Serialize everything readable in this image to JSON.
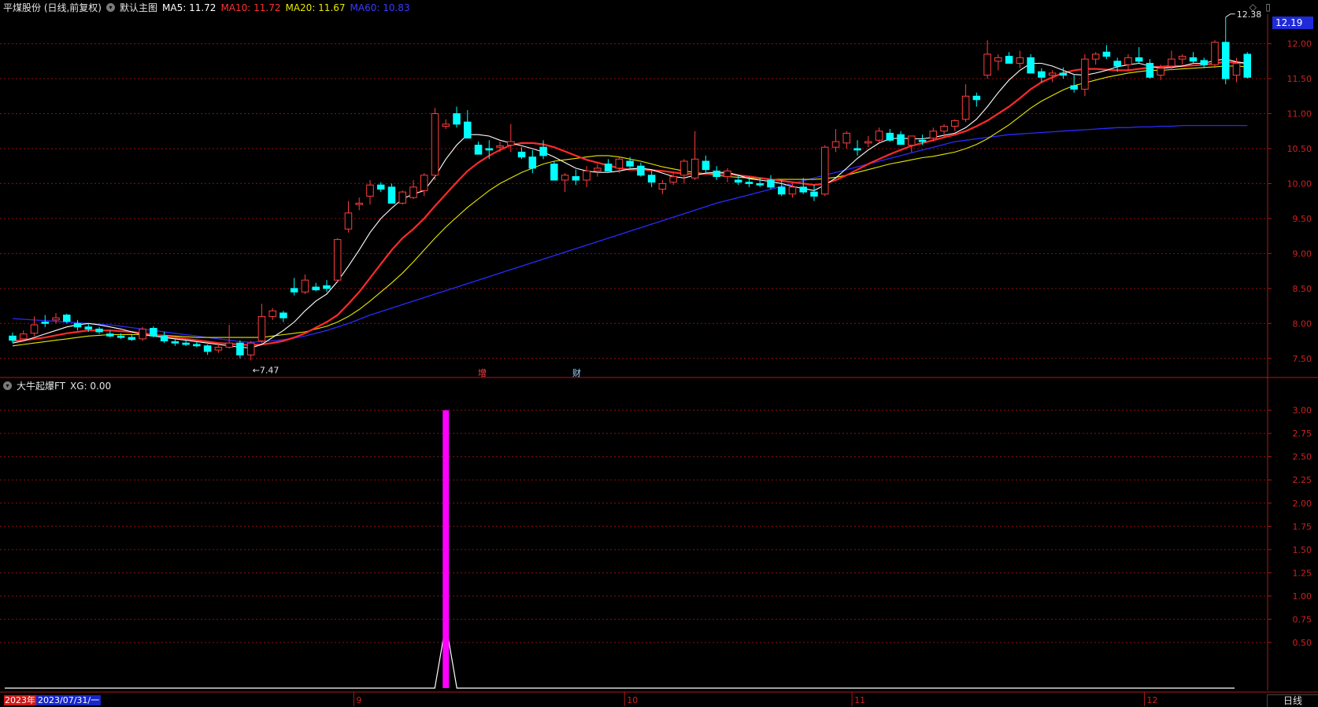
{
  "main_header": {
    "title": "平煤股份 (日线,前复权)",
    "template": "默认主图",
    "ma5": "MA5: 11.72",
    "ma10": "MA10: 11.72",
    "ma20": "MA20: 11.67",
    "ma60": "MA60: 10.83"
  },
  "sub_header": {
    "title": "大牛起爆FT",
    "value": "XG: 0.00"
  },
  "current_price": "12.19",
  "period_button": "日线",
  "date_cursor": {
    "year": "2023年",
    "date": "2023/07/31/一"
  },
  "event_markers": {
    "zeng": "增",
    "cai": "财"
  },
  "colors": {
    "up": "#ff3d3d",
    "down": "#00ffff",
    "ma5": "#ffffff",
    "ma10": "#ff2a2a",
    "ma20": "#e8e800",
    "ma60": "#2a2aff",
    "grid": "#8a1010",
    "xg": "#ff00ff"
  },
  "icons": {
    "dropdown": "chevron-down-icon",
    "diamond": "diamond-icon",
    "panel": "panel-toggle-icon"
  },
  "chart_data": [
    {
      "type": "candlestick",
      "title": "平煤股份 (日线,前复权)",
      "ylim": [
        7.25,
        12.4
      ],
      "y_ticks": [
        "7.50",
        "8.00",
        "8.50",
        "9.00",
        "9.50",
        "10.00",
        "10.50",
        "11.00",
        "11.50",
        "12.00"
      ],
      "x_ticks": [
        "9",
        "10",
        "11",
        "12"
      ],
      "x_tick_index": [
        32,
        57,
        78,
        105
      ],
      "annotations": {
        "high": "12.38",
        "low": "7.47"
      },
      "ohlc": [
        [
          7.82,
          7.87,
          7.72,
          7.76
        ],
        [
          7.78,
          7.9,
          7.75,
          7.85
        ],
        [
          7.86,
          8.1,
          7.82,
          7.98
        ],
        [
          8.02,
          8.12,
          7.95,
          8.0
        ],
        [
          8.05,
          8.15,
          8.0,
          8.08
        ],
        [
          8.12,
          8.14,
          8.0,
          8.03
        ],
        [
          8.0,
          8.05,
          7.9,
          7.95
        ],
        [
          7.95,
          8.0,
          7.88,
          7.92
        ],
        [
          7.92,
          7.95,
          7.85,
          7.88
        ],
        [
          7.85,
          7.9,
          7.8,
          7.82
        ],
        [
          7.82,
          7.86,
          7.78,
          7.8
        ],
        [
          7.8,
          7.85,
          7.75,
          7.77
        ],
        [
          7.78,
          7.95,
          7.75,
          7.92
        ],
        [
          7.93,
          7.96,
          7.8,
          7.82
        ],
        [
          7.82,
          7.88,
          7.72,
          7.75
        ],
        [
          7.74,
          7.78,
          7.68,
          7.72
        ],
        [
          7.72,
          7.76,
          7.68,
          7.7
        ],
        [
          7.7,
          7.74,
          7.66,
          7.68
        ],
        [
          7.68,
          7.7,
          7.55,
          7.6
        ],
        [
          7.62,
          7.7,
          7.58,
          7.66
        ],
        [
          7.66,
          7.98,
          7.64,
          7.72
        ],
        [
          7.72,
          7.76,
          7.5,
          7.55
        ],
        [
          7.55,
          7.75,
          7.47,
          7.72
        ],
        [
          7.75,
          8.28,
          7.72,
          8.1
        ],
        [
          8.1,
          8.22,
          8.05,
          8.18
        ],
        [
          8.15,
          8.18,
          8.02,
          8.08
        ],
        [
          8.5,
          8.65,
          8.4,
          8.45
        ],
        [
          8.45,
          8.7,
          8.42,
          8.62
        ],
        [
          8.52,
          8.58,
          8.46,
          8.48
        ],
        [
          8.54,
          8.62,
          8.45,
          8.5
        ],
        [
          8.62,
          9.22,
          8.58,
          9.2
        ],
        [
          9.35,
          9.75,
          9.3,
          9.58
        ],
        [
          9.7,
          9.8,
          9.62,
          9.72
        ],
        [
          9.82,
          10.05,
          9.7,
          9.98
        ],
        [
          9.98,
          10.02,
          9.88,
          9.92
        ],
        [
          9.95,
          10.0,
          9.78,
          9.72
        ],
        [
          9.72,
          9.9,
          9.7,
          9.88
        ],
        [
          9.8,
          10.05,
          9.78,
          9.95
        ],
        [
          9.9,
          10.15,
          9.82,
          10.12
        ],
        [
          10.12,
          11.08,
          10.05,
          11.0
        ],
        [
          10.82,
          10.92,
          10.78,
          10.85
        ],
        [
          11.0,
          11.1,
          10.8,
          10.85
        ],
        [
          10.88,
          11.05,
          10.65,
          10.65
        ],
        [
          10.55,
          10.6,
          10.45,
          10.42
        ],
        [
          10.5,
          10.62,
          10.35,
          10.48
        ],
        [
          10.52,
          10.6,
          10.45,
          10.54
        ],
        [
          10.55,
          10.85,
          10.45,
          10.6
        ],
        [
          10.45,
          10.52,
          10.35,
          10.38
        ],
        [
          10.38,
          10.48,
          10.15,
          10.22
        ],
        [
          10.52,
          10.62,
          10.35,
          10.4
        ],
        [
          10.28,
          10.32,
          10.05,
          10.05
        ],
        [
          10.05,
          10.15,
          9.88,
          10.12
        ],
        [
          10.1,
          10.2,
          9.98,
          10.05
        ],
        [
          10.05,
          10.25,
          9.95,
          10.18
        ],
        [
          10.18,
          10.28,
          10.1,
          10.22
        ],
        [
          10.28,
          10.35,
          10.2,
          10.18
        ],
        [
          10.22,
          10.38,
          10.15,
          10.35
        ],
        [
          10.32,
          10.38,
          10.22,
          10.25
        ],
        [
          10.25,
          10.3,
          10.1,
          10.12
        ],
        [
          10.12,
          10.18,
          9.95,
          10.02
        ],
        [
          9.92,
          10.05,
          9.85,
          10.0
        ],
        [
          10.02,
          10.15,
          9.98,
          10.1
        ],
        [
          10.12,
          10.35,
          10.0,
          10.32
        ],
        [
          10.08,
          10.75,
          10.05,
          10.35
        ],
        [
          10.32,
          10.4,
          10.15,
          10.2
        ],
        [
          10.18,
          10.25,
          10.05,
          10.1
        ],
        [
          10.1,
          10.22,
          10.02,
          10.18
        ],
        [
          10.05,
          10.12,
          9.98,
          10.02
        ],
        [
          10.02,
          10.1,
          9.95,
          10.0
        ],
        [
          10.0,
          10.08,
          9.95,
          9.98
        ],
        [
          10.05,
          10.12,
          9.92,
          9.95
        ],
        [
          9.95,
          10.05,
          9.82,
          9.85
        ],
        [
          9.85,
          10.0,
          9.8,
          9.95
        ],
        [
          9.95,
          10.08,
          9.85,
          9.88
        ],
        [
          9.88,
          9.98,
          9.75,
          9.82
        ],
        [
          9.85,
          10.55,
          9.82,
          10.52
        ],
        [
          10.52,
          10.78,
          10.45,
          10.6
        ],
        [
          10.58,
          10.75,
          10.5,
          10.72
        ],
        [
          10.5,
          10.62,
          10.4,
          10.48
        ],
        [
          10.58,
          10.68,
          10.52,
          10.6
        ],
        [
          10.62,
          10.8,
          10.58,
          10.75
        ],
        [
          10.72,
          10.78,
          10.6,
          10.62
        ],
        [
          10.7,
          10.75,
          10.58,
          10.56
        ],
        [
          10.55,
          10.68,
          10.45,
          10.68
        ],
        [
          10.62,
          10.7,
          10.55,
          10.6
        ],
        [
          10.65,
          10.8,
          10.6,
          10.75
        ],
        [
          10.75,
          10.85,
          10.65,
          10.82
        ],
        [
          10.82,
          10.92,
          10.75,
          10.9
        ],
        [
          10.92,
          11.42,
          10.88,
          11.25
        ],
        [
          11.25,
          11.3,
          11.1,
          11.2
        ],
        [
          11.55,
          12.05,
          11.5,
          11.85
        ],
        [
          11.75,
          11.85,
          11.62,
          11.8
        ],
        [
          11.82,
          11.88,
          11.75,
          11.72
        ],
        [
          11.72,
          11.9,
          11.65,
          11.8
        ],
        [
          11.8,
          11.85,
          11.6,
          11.58
        ],
        [
          11.6,
          11.65,
          11.45,
          11.52
        ],
        [
          11.55,
          11.62,
          11.45,
          11.58
        ],
        [
          11.58,
          11.66,
          11.5,
          11.55
        ],
        [
          11.4,
          11.55,
          11.3,
          11.35
        ],
        [
          11.35,
          11.85,
          11.25,
          11.78
        ],
        [
          11.78,
          11.88,
          11.7,
          11.85
        ],
        [
          11.88,
          11.98,
          11.78,
          11.82
        ],
        [
          11.75,
          11.8,
          11.6,
          11.68
        ],
        [
          11.7,
          11.85,
          11.62,
          11.8
        ],
        [
          11.8,
          11.95,
          11.72,
          11.75
        ],
        [
          11.72,
          11.78,
          11.5,
          11.52
        ],
        [
          11.55,
          11.7,
          11.48,
          11.65
        ],
        [
          11.68,
          11.9,
          11.62,
          11.78
        ],
        [
          11.78,
          11.85,
          11.7,
          11.82
        ],
        [
          11.8,
          11.88,
          11.72,
          11.75
        ],
        [
          11.76,
          11.8,
          11.65,
          11.7
        ],
        [
          11.7,
          12.05,
          11.65,
          12.02
        ],
        [
          12.02,
          12.38,
          11.42,
          11.5
        ],
        [
          11.55,
          11.8,
          11.45,
          11.72
        ],
        [
          11.85,
          11.88,
          11.5,
          11.52
        ]
      ],
      "ma5": [
        7.72,
        7.75,
        7.8,
        7.85,
        7.9,
        7.95,
        7.98,
        8.0,
        7.98,
        7.95,
        7.92,
        7.88,
        7.84,
        7.82,
        7.8,
        7.78,
        7.76,
        7.74,
        7.72,
        7.7,
        7.68,
        7.66,
        7.65,
        7.7,
        7.8,
        7.9,
        8.02,
        8.18,
        8.32,
        8.42,
        8.6,
        8.82,
        9.05,
        9.3,
        9.5,
        9.65,
        9.78,
        9.85,
        9.9,
        10.1,
        10.35,
        10.55,
        10.7,
        10.7,
        10.68,
        10.62,
        10.58,
        10.54,
        10.5,
        10.45,
        10.38,
        10.3,
        10.22,
        10.18,
        10.16,
        10.16,
        10.18,
        10.21,
        10.22,
        10.2,
        10.15,
        10.1,
        10.08,
        10.12,
        10.15,
        10.16,
        10.16,
        10.12,
        10.07,
        10.05,
        10.03,
        10.0,
        9.96,
        9.93,
        9.9,
        9.98,
        10.08,
        10.22,
        10.36,
        10.48,
        10.58,
        10.64,
        10.65,
        10.64,
        10.64,
        10.66,
        10.69,
        10.72,
        10.8,
        10.92,
        11.1,
        11.3,
        11.48,
        11.62,
        11.72,
        11.72,
        11.68,
        11.62,
        11.56,
        11.55,
        11.58,
        11.62,
        11.67,
        11.7,
        11.72,
        11.68,
        11.65,
        11.66,
        11.68,
        11.72,
        11.72,
        11.76,
        11.78,
        11.74,
        11.72
      ],
      "ma10": [
        7.75,
        7.76,
        7.78,
        7.8,
        7.83,
        7.86,
        7.88,
        7.9,
        7.9,
        7.9,
        7.89,
        7.88,
        7.86,
        7.84,
        7.82,
        7.8,
        7.78,
        7.76,
        7.74,
        7.72,
        7.71,
        7.7,
        7.69,
        7.7,
        7.72,
        7.75,
        7.8,
        7.86,
        7.94,
        8.02,
        8.12,
        8.28,
        8.45,
        8.65,
        8.85,
        9.05,
        9.22,
        9.35,
        9.5,
        9.68,
        9.85,
        10.02,
        10.18,
        10.3,
        10.4,
        10.48,
        10.55,
        10.58,
        10.58,
        10.56,
        10.52,
        10.46,
        10.4,
        10.34,
        10.3,
        10.26,
        10.22,
        10.2,
        10.2,
        10.19,
        10.18,
        10.16,
        10.14,
        10.14,
        10.14,
        10.14,
        10.14,
        10.12,
        10.1,
        10.08,
        10.06,
        10.04,
        10.02,
        10.0,
        9.98,
        10.0,
        10.05,
        10.12,
        10.2,
        10.28,
        10.35,
        10.42,
        10.48,
        10.54,
        10.58,
        10.62,
        10.66,
        10.7,
        10.75,
        10.82,
        10.9,
        11.0,
        11.1,
        11.22,
        11.35,
        11.45,
        11.52,
        11.58,
        11.62,
        11.64,
        11.64,
        11.63,
        11.62,
        11.62,
        11.64,
        11.66,
        11.67,
        11.68,
        11.68,
        11.69,
        11.7,
        11.72,
        11.74,
        11.73,
        11.72
      ],
      "ma20": [
        7.68,
        7.7,
        7.72,
        7.74,
        7.76,
        7.78,
        7.8,
        7.82,
        7.83,
        7.84,
        7.84,
        7.84,
        7.84,
        7.84,
        7.83,
        7.82,
        7.81,
        7.8,
        7.8,
        7.8,
        7.8,
        7.8,
        7.8,
        7.8,
        7.82,
        7.84,
        7.86,
        7.88,
        7.92,
        7.96,
        8.02,
        8.1,
        8.2,
        8.32,
        8.45,
        8.58,
        8.72,
        8.88,
        9.05,
        9.22,
        9.38,
        9.52,
        9.66,
        9.78,
        9.9,
        10.0,
        10.08,
        10.16,
        10.22,
        10.28,
        10.32,
        10.34,
        10.36,
        10.38,
        10.4,
        10.4,
        10.38,
        10.35,
        10.32,
        10.28,
        10.24,
        10.21,
        10.18,
        10.16,
        10.14,
        10.12,
        10.1,
        10.09,
        10.08,
        10.07,
        10.06,
        10.06,
        10.06,
        10.06,
        10.06,
        10.07,
        10.09,
        10.12,
        10.16,
        10.2,
        10.24,
        10.28,
        10.31,
        10.34,
        10.37,
        10.39,
        10.42,
        10.45,
        10.5,
        10.56,
        10.64,
        10.74,
        10.84,
        10.96,
        11.08,
        11.18,
        11.26,
        11.34,
        11.4,
        11.44,
        11.48,
        11.52,
        11.55,
        11.58,
        11.6,
        11.62,
        11.62,
        11.63,
        11.64,
        11.65,
        11.66,
        11.67,
        11.68,
        11.68,
        11.67
      ],
      "ma60": [
        8.07,
        8.06,
        8.05,
        8.04,
        8.03,
        8.02,
        8.01,
        8.0,
        7.99,
        7.98,
        7.96,
        7.94,
        7.92,
        7.9,
        7.88,
        7.86,
        7.84,
        7.82,
        7.8,
        7.78,
        7.76,
        7.74,
        7.73,
        7.74,
        7.75,
        7.77,
        7.79,
        7.82,
        7.86,
        7.9,
        7.95,
        8.0,
        8.06,
        8.12,
        8.17,
        8.22,
        8.27,
        8.32,
        8.37,
        8.42,
        8.47,
        8.52,
        8.57,
        8.62,
        8.67,
        8.72,
        8.77,
        8.82,
        8.87,
        8.92,
        8.97,
        9.02,
        9.07,
        9.12,
        9.17,
        9.22,
        9.27,
        9.32,
        9.37,
        9.42,
        9.47,
        9.52,
        9.57,
        9.62,
        9.67,
        9.72,
        9.76,
        9.8,
        9.84,
        9.88,
        9.92,
        9.96,
        10.0,
        10.04,
        10.08,
        10.12,
        10.16,
        10.2,
        10.24,
        10.28,
        10.32,
        10.36,
        10.4,
        10.44,
        10.48,
        10.52,
        10.56,
        10.6,
        10.62,
        10.64,
        10.66,
        10.68,
        10.7,
        10.71,
        10.72,
        10.73,
        10.74,
        10.75,
        10.76,
        10.77,
        10.78,
        10.79,
        10.8,
        10.8,
        10.81,
        10.81,
        10.82,
        10.82,
        10.83,
        10.83,
        10.83,
        10.83,
        10.83,
        10.83,
        10.83
      ]
    },
    {
      "type": "bar",
      "title": "大牛起爆FT",
      "series_name": "XG",
      "ylim": [
        0,
        3.2
      ],
      "y_ticks": [
        "0.50",
        "0.75",
        "1.00",
        "1.25",
        "1.50",
        "1.75",
        "2.00",
        "2.25",
        "2.50",
        "2.75",
        "3.00"
      ],
      "spike_index": 40,
      "spike_value": 3.0,
      "line_peak": 0.7
    }
  ]
}
